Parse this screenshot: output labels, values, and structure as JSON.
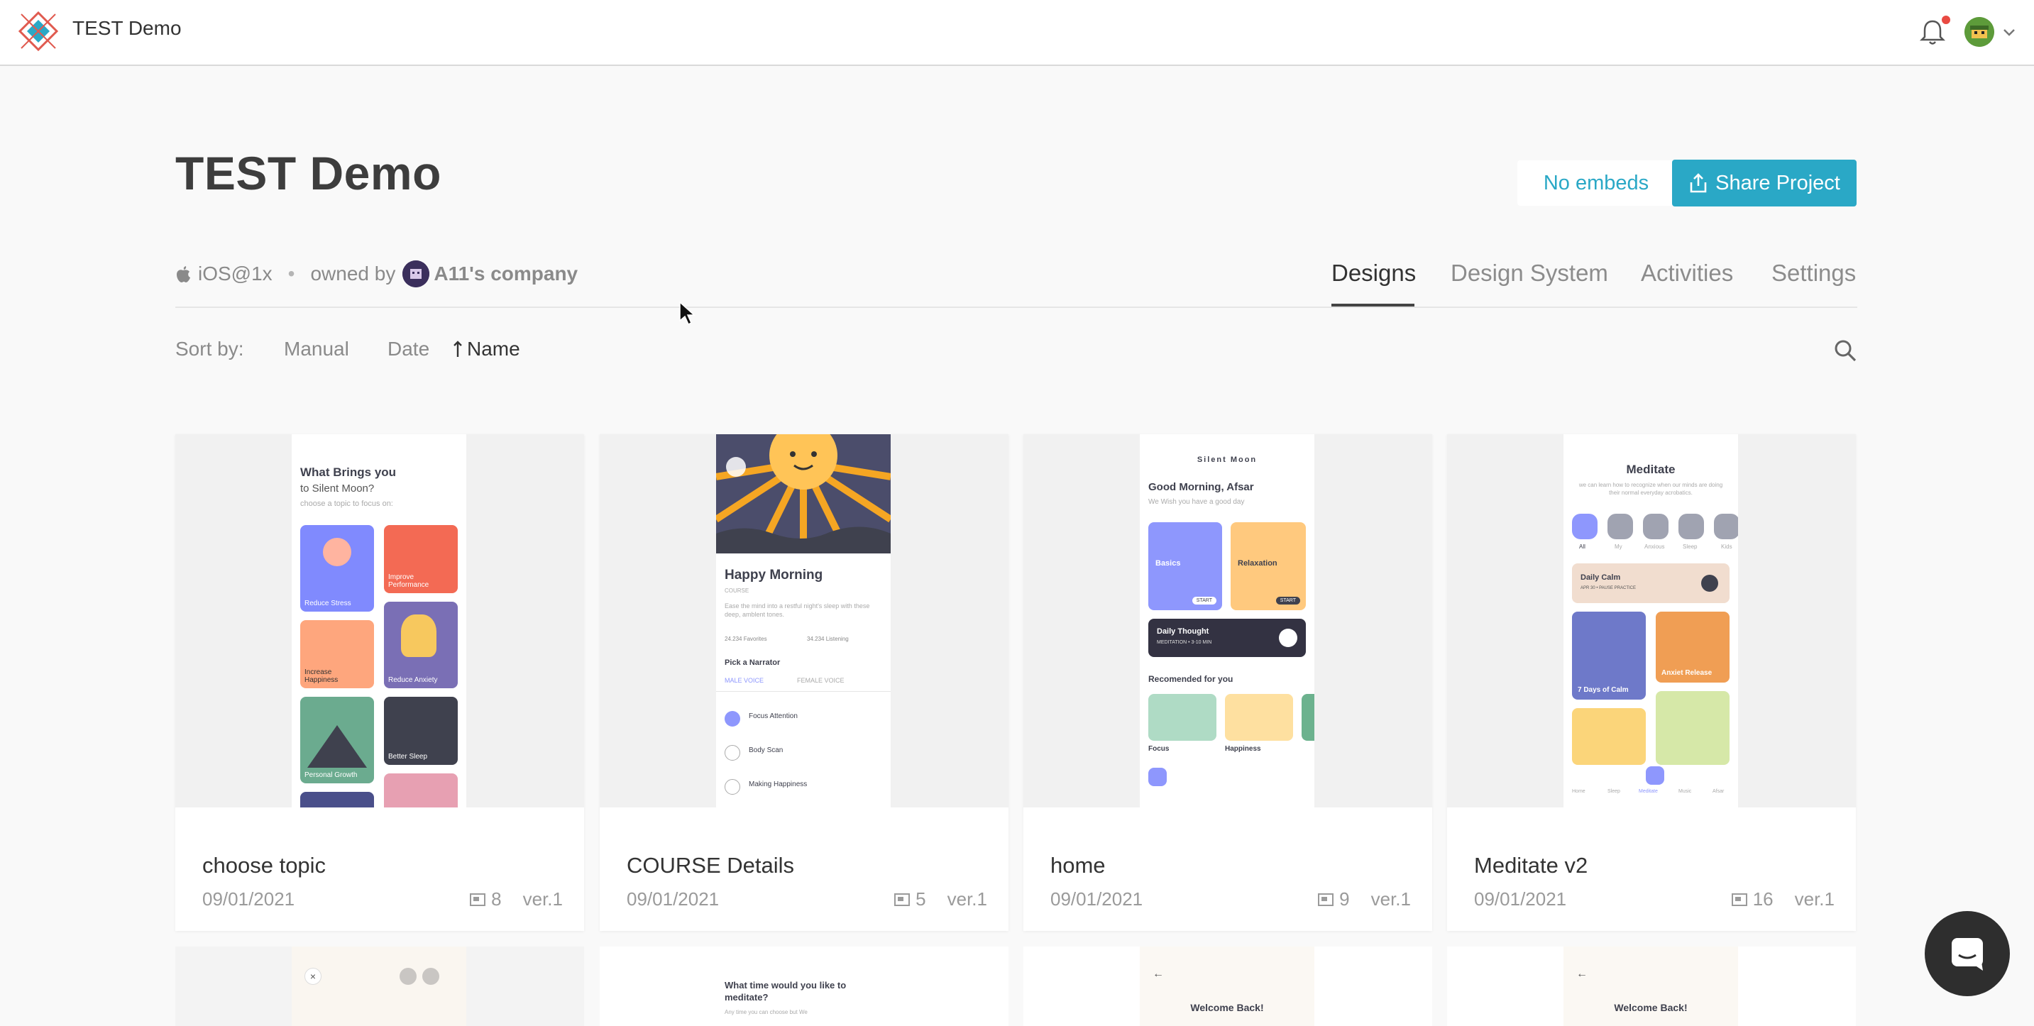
{
  "app": {
    "title": "TEST Demo"
  },
  "header": {
    "icons": [
      "logo-icon",
      "bell-icon",
      "avatar-icon",
      "chevron-down-icon"
    ]
  },
  "project": {
    "title": "TEST Demo",
    "platform": "iOS@1x",
    "owned_by_label": "owned by",
    "owner": "A11's company",
    "embeds_label": "No embeds",
    "share_label": "Share Project"
  },
  "tabs": [
    "Designs",
    "Design System",
    "Activities",
    "Settings"
  ],
  "active_tab": "Designs",
  "sort": {
    "label": "Sort by:",
    "options": [
      "Manual",
      "Date",
      "Name"
    ],
    "active": "Name"
  },
  "cards": [
    {
      "name": "choose topic",
      "date": "09/01/2021",
      "count": "8",
      "version": "ver.1"
    },
    {
      "name": "COURSE Details",
      "date": "09/01/2021",
      "count": "5",
      "version": "ver.1"
    },
    {
      "name": "home",
      "date": "09/01/2021",
      "count": "9",
      "version": "ver.1"
    },
    {
      "name": "Meditate v2",
      "date": "09/01/2021",
      "count": "16",
      "version": "ver.1"
    }
  ],
  "thumb_text": {
    "choose": {
      "title": "What Brings you",
      "subtitle": "to Silent Moon?",
      "hint": "choose a topic to focus on:",
      "tiles": [
        "Reduce Stress",
        "Improve Performance",
        "Increase Happiness",
        "Reduce Anxiety",
        "Personal Growth",
        "Better Sleep"
      ]
    },
    "course": {
      "title": "Happy Morning",
      "label": "COURSE",
      "desc": "Ease the mind into a restful night's sleep with these deep, amblent tones.",
      "favorites": "24.234 Favorites",
      "listening": "34.234 Listening",
      "narrator": "Pick a Narrator",
      "male": "MALE VOICE",
      "female": "FEMALE VOICE",
      "items": [
        "Focus Attention",
        "Body Scan",
        "Making Happiness"
      ]
    },
    "home": {
      "brand": "Silent Moon",
      "greeting": "Good Morning, Afsar",
      "sub": "We Wish you have a good day",
      "tile1": "Basics",
      "tile2": "Relaxation",
      "daily": "Daily Thought",
      "daily_sub": "MEDITATION • 3-10 MIN",
      "recommended": "Recomended for you",
      "rec1": "Focus",
      "rec2": "Happiness",
      "start": "START"
    },
    "meditate": {
      "title": "Meditate",
      "desc": "we can learn how to recognize when our minds are doing their normal everyday acrobatics.",
      "cats": [
        "All",
        "My",
        "Anxious",
        "Sleep",
        "Kids"
      ],
      "calm": "Daily Calm",
      "calm_sub": "APR 30 • PAUSE PRACTICE",
      "t1": "7 Days of Calm",
      "t2": "Anxiet Release",
      "nav": [
        "Home",
        "Sleep",
        "Meditate",
        "Music",
        "Afsar"
      ]
    },
    "row2": {
      "meditate_q": "What time would you like to meditate?",
      "meditate_hint": "Any time you can choose but We",
      "welcome": "Welcome Back!"
    }
  },
  "colors": {
    "accent": "#2aa8c6",
    "notification": "#e94a42"
  }
}
